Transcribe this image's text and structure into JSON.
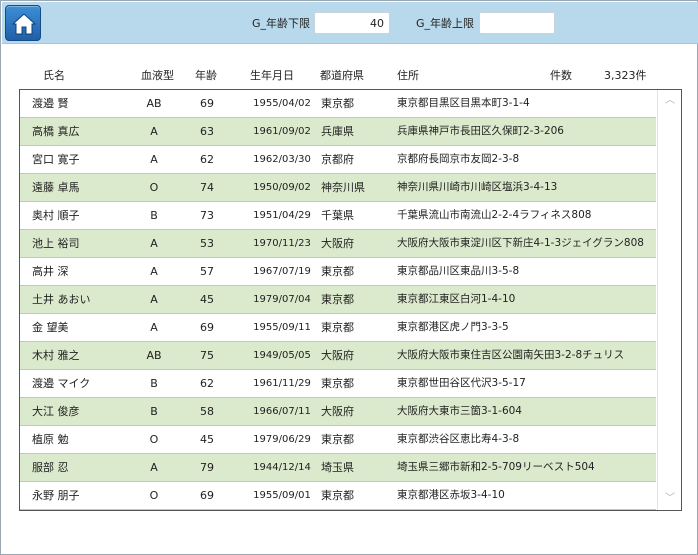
{
  "toolbar": {
    "home_icon": "home-icon",
    "age_min_label": "G_年齢下限",
    "age_min_value": "40",
    "age_max_label": "G_年齢上限",
    "age_max_value": ""
  },
  "columns": {
    "name": "氏名",
    "blood": "血液型",
    "age": "年齢",
    "birth": "生年月日",
    "pref": "都道府県",
    "address": "住所",
    "count_label": "件数",
    "count_value": "3,323件"
  },
  "rows": [
    {
      "name": "渡邉 賢",
      "blood": "AB",
      "age": "69",
      "birth": "1955/04/02",
      "pref": "東京都",
      "address": "東京都目黒区目黒本町3-1-4"
    },
    {
      "name": "高橋 真広",
      "blood": "A",
      "age": "63",
      "birth": "1961/09/02",
      "pref": "兵庫県",
      "address": "兵庫県神戸市長田区久保町2-3-206"
    },
    {
      "name": "宮口 寛子",
      "blood": "A",
      "age": "62",
      "birth": "1962/03/30",
      "pref": "京都府",
      "address": "京都府長岡京市友岡2-3-8"
    },
    {
      "name": "遠藤 卓馬",
      "blood": "O",
      "age": "74",
      "birth": "1950/09/02",
      "pref": "神奈川県",
      "address": "神奈川県川崎市川崎区塩浜3-4-13"
    },
    {
      "name": "奥村 順子",
      "blood": "B",
      "age": "73",
      "birth": "1951/04/29",
      "pref": "千葉県",
      "address": "千葉県流山市南流山2-2-4ラフィネス808"
    },
    {
      "name": "池上 裕司",
      "blood": "A",
      "age": "53",
      "birth": "1970/11/23",
      "pref": "大阪府",
      "address": "大阪府大阪市東淀川区下新庄4-1-3ジェイグラン808"
    },
    {
      "name": "高井 深",
      "blood": "A",
      "age": "57",
      "birth": "1967/07/19",
      "pref": "東京都",
      "address": "東京都品川区東品川3-5-8"
    },
    {
      "name": "土井 あおい",
      "blood": "A",
      "age": "45",
      "birth": "1979/07/04",
      "pref": "東京都",
      "address": "東京都江東区白河1-4-10"
    },
    {
      "name": "金 望美",
      "blood": "A",
      "age": "69",
      "birth": "1955/09/11",
      "pref": "東京都",
      "address": "東京都港区虎ノ門3-3-5"
    },
    {
      "name": "木村 雅之",
      "blood": "AB",
      "age": "75",
      "birth": "1949/05/05",
      "pref": "大阪府",
      "address": "大阪府大阪市東住吉区公園南矢田3-2-8チュリス"
    },
    {
      "name": "渡邉 マイク",
      "blood": "B",
      "age": "62",
      "birth": "1961/11/29",
      "pref": "東京都",
      "address": "東京都世田谷区代沢3-5-17"
    },
    {
      "name": "大江 俊彦",
      "blood": "B",
      "age": "58",
      "birth": "1966/07/11",
      "pref": "大阪府",
      "address": "大阪府大東市三箇3-1-604"
    },
    {
      "name": "植原 勉",
      "blood": "O",
      "age": "45",
      "birth": "1979/06/29",
      "pref": "東京都",
      "address": "東京都渋谷区恵比寿4-3-8"
    },
    {
      "name": "服部 忍",
      "blood": "A",
      "age": "79",
      "birth": "1944/12/14",
      "pref": "埼玉県",
      "address": "埼玉県三郷市新和2-5-709リーベスト504"
    },
    {
      "name": "永野 朋子",
      "blood": "O",
      "age": "69",
      "birth": "1955/09/01",
      "pref": "東京都",
      "address": "東京都港区赤坂3-4-10"
    }
  ],
  "scrollbar": {
    "up_icon": "chevron-up-icon",
    "down_icon": "chevron-down-icon"
  },
  "colors": {
    "topbar": "#b8d9ec",
    "row_alt": "#dbe9cc",
    "home_button": "#2f7ac6"
  }
}
